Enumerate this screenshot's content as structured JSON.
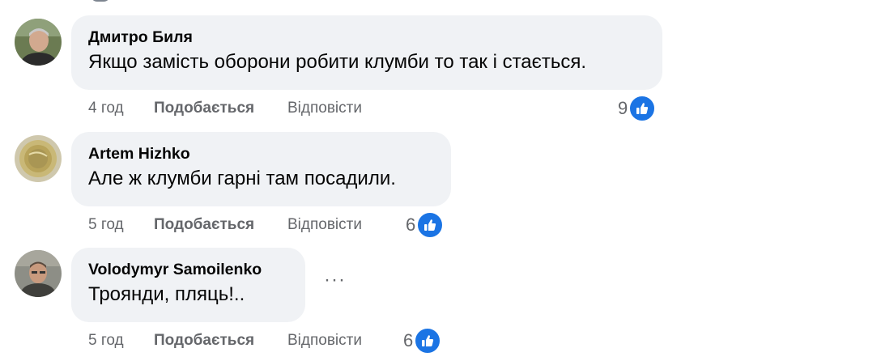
{
  "comments": [
    {
      "author": "Дмитро Биля",
      "text": "Якщо замість оборони робити клумби то так і стається.",
      "time": "4 год",
      "like_label": "Подобається",
      "reply_label": "Відповісти",
      "reaction_count": "9",
      "reaction_icon": "thumbs-up-icon"
    },
    {
      "author": "Artem Hizhko",
      "text": "Але ж клумби гарні там посадили.",
      "time": "5 год",
      "like_label": "Подобається",
      "reply_label": "Відповісти",
      "reaction_count": "6",
      "reaction_icon": "thumbs-up-icon"
    },
    {
      "author": "Volodymyr Samoilenko",
      "text": "Троянди, пляць!..",
      "time": "5 год",
      "like_label": "Подобається",
      "reply_label": "Відповісти",
      "reaction_count": "6",
      "reaction_icon": "thumbs-up-icon"
    }
  ],
  "more_options_icon": "more-options-icon",
  "colors": {
    "bubble": "#f0f2f5",
    "meta_text": "#65676b",
    "like_blue": "#1b74e4"
  }
}
